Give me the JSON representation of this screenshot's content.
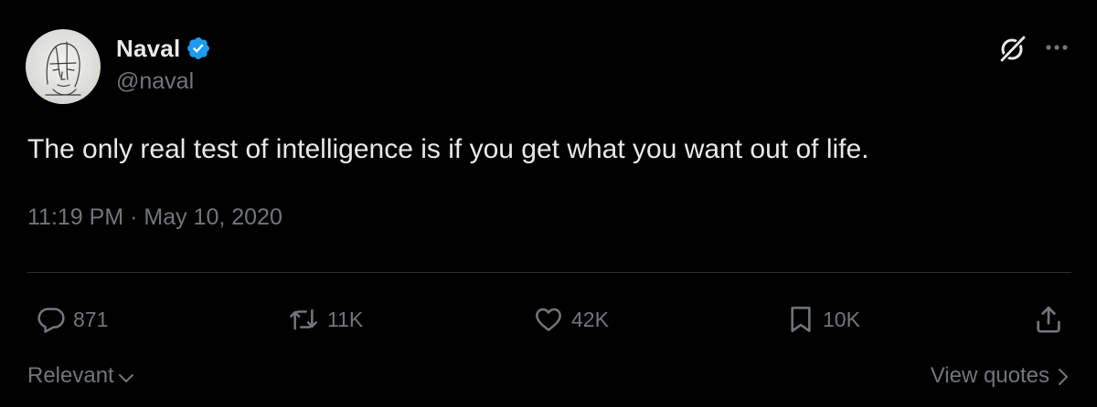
{
  "author": {
    "display_name": "Naval",
    "handle": "@naval",
    "verified": true,
    "verified_color": "#1d9bf0"
  },
  "header_icons": {
    "grok": "grok-icon",
    "more": "more-icon"
  },
  "tweet": {
    "text": "The only real test of intelligence is if you get what you want out of life.",
    "timestamp": "11:19 PM · May 10, 2020"
  },
  "actions": {
    "reply": {
      "icon": "reply-icon",
      "count": "871"
    },
    "retweet": {
      "icon": "retweet-icon",
      "count": "11K"
    },
    "like": {
      "icon": "heart-icon",
      "count": "42K"
    },
    "bookmark": {
      "icon": "bookmark-icon",
      "count": "10K"
    },
    "share": {
      "icon": "share-icon"
    }
  },
  "footer": {
    "sort_label": "Relevant",
    "view_quotes_label": "View quotes"
  },
  "colors": {
    "background": "#000000",
    "primary_text": "#e7e9ea",
    "secondary_text": "#71767b",
    "divider": "#2f3336"
  }
}
